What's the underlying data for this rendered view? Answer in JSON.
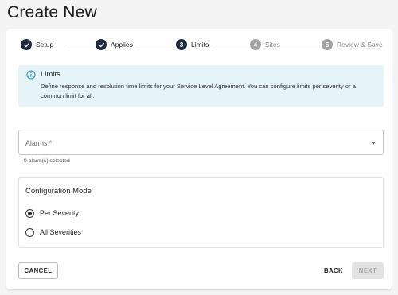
{
  "page": {
    "title": "Create New"
  },
  "stepper": {
    "steps": [
      {
        "label": "Setup",
        "number": "",
        "state": "done"
      },
      {
        "label": "Applies",
        "number": "",
        "state": "done"
      },
      {
        "label": "Limits",
        "number": "3",
        "state": "active"
      },
      {
        "label": "Sites",
        "number": "4",
        "state": "pending"
      },
      {
        "label": "Review & Save",
        "number": "5",
        "state": "pending"
      }
    ]
  },
  "banner": {
    "icon": "info-icon",
    "title": "Limits",
    "text": "Define response and resolution time limits for your Service Level Agreement. You can configure limits per severity or a common limit for all."
  },
  "alarms": {
    "label": "Alarms *",
    "helper": "0 alarm(s) selected"
  },
  "config": {
    "title": "Configuration Mode",
    "options": [
      {
        "label": "Per Severity",
        "selected": true
      },
      {
        "label": "All Severities",
        "selected": false
      }
    ]
  },
  "footer": {
    "cancel": "CANCEL",
    "back": "BACK",
    "next": "NEXT"
  },
  "colors": {
    "accent_dark": "#1f2a3c",
    "banner_bg": "#e6f4fa",
    "info_blue": "#1a8fc4",
    "disabled": "#e2e2e2"
  }
}
